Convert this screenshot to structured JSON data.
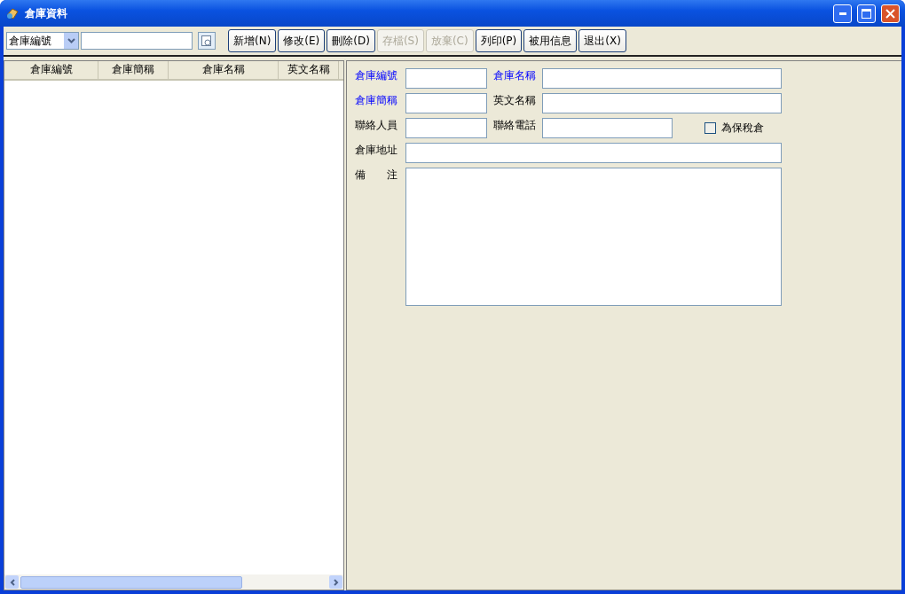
{
  "window": {
    "title": "倉庫資料"
  },
  "toolbar": {
    "search_by": "倉庫編號",
    "buttons": [
      {
        "label": "新增(N)",
        "disabled": false
      },
      {
        "label": "修改(E)",
        "disabled": false
      },
      {
        "label": "刪除(D)",
        "disabled": false
      },
      {
        "label": "存檔(S)",
        "disabled": true
      },
      {
        "label": "放棄(C)",
        "disabled": true
      },
      {
        "label": "列印(P)",
        "disabled": false
      },
      {
        "label": "被用信息",
        "disabled": false
      },
      {
        "label": "退出(X)",
        "disabled": false
      }
    ]
  },
  "table": {
    "columns": [
      "倉庫編號",
      "倉庫簡稱",
      "倉庫名稱",
      "英文名稱"
    ]
  },
  "form": {
    "fields": [
      {
        "label": "倉庫編號",
        "required": true
      },
      {
        "label": "倉庫名稱",
        "required": true
      },
      {
        "label": "倉庫簡稱",
        "required": true
      },
      {
        "label": "英文名稱",
        "required": false
      },
      {
        "label": "聯絡人員",
        "required": false
      },
      {
        "label": "聯絡電話",
        "required": false
      },
      {
        "label": "倉庫地址",
        "required": false
      }
    ],
    "checkbox": {
      "label": "為保稅倉",
      "checked": false
    },
    "remarks": {
      "label": "備　　注"
    }
  }
}
